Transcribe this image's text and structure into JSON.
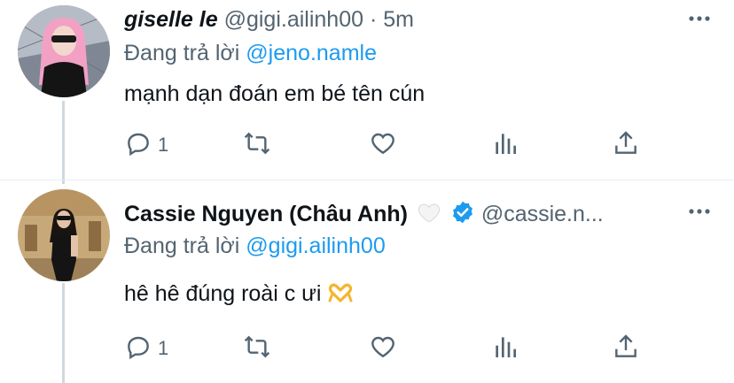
{
  "tweets": [
    {
      "name": "giselle le",
      "handle": "@gigi.ailinh00",
      "separator": "·",
      "time": "5m",
      "replying_prefix": "Đang trả lời",
      "replying_to": "@jeno.namle",
      "text": "mạnh dạn đoán em bé tên cún",
      "reply_count": "1",
      "avatar": "pink-hair-avatar"
    },
    {
      "name": "Cassie Nguyen (Châu Anh)",
      "handle": "@cassie.n...",
      "replying_prefix": "Đang trả lời",
      "replying_to": "@gigi.ailinh00",
      "text": "hê hê đúng roài c ưi",
      "reply_count": "1",
      "avatar": "black-outfit-avatar"
    }
  ],
  "colors": {
    "accent": "#1d9bf0",
    "secondary_text": "#536471",
    "thread_line": "#cfd9de"
  },
  "icons": [
    "more-icon",
    "reply-icon",
    "retweet-icon",
    "like-icon",
    "analytics-icon",
    "share-icon",
    "verified-icon",
    "white-heart-icon",
    "heart-hands-icon"
  ]
}
